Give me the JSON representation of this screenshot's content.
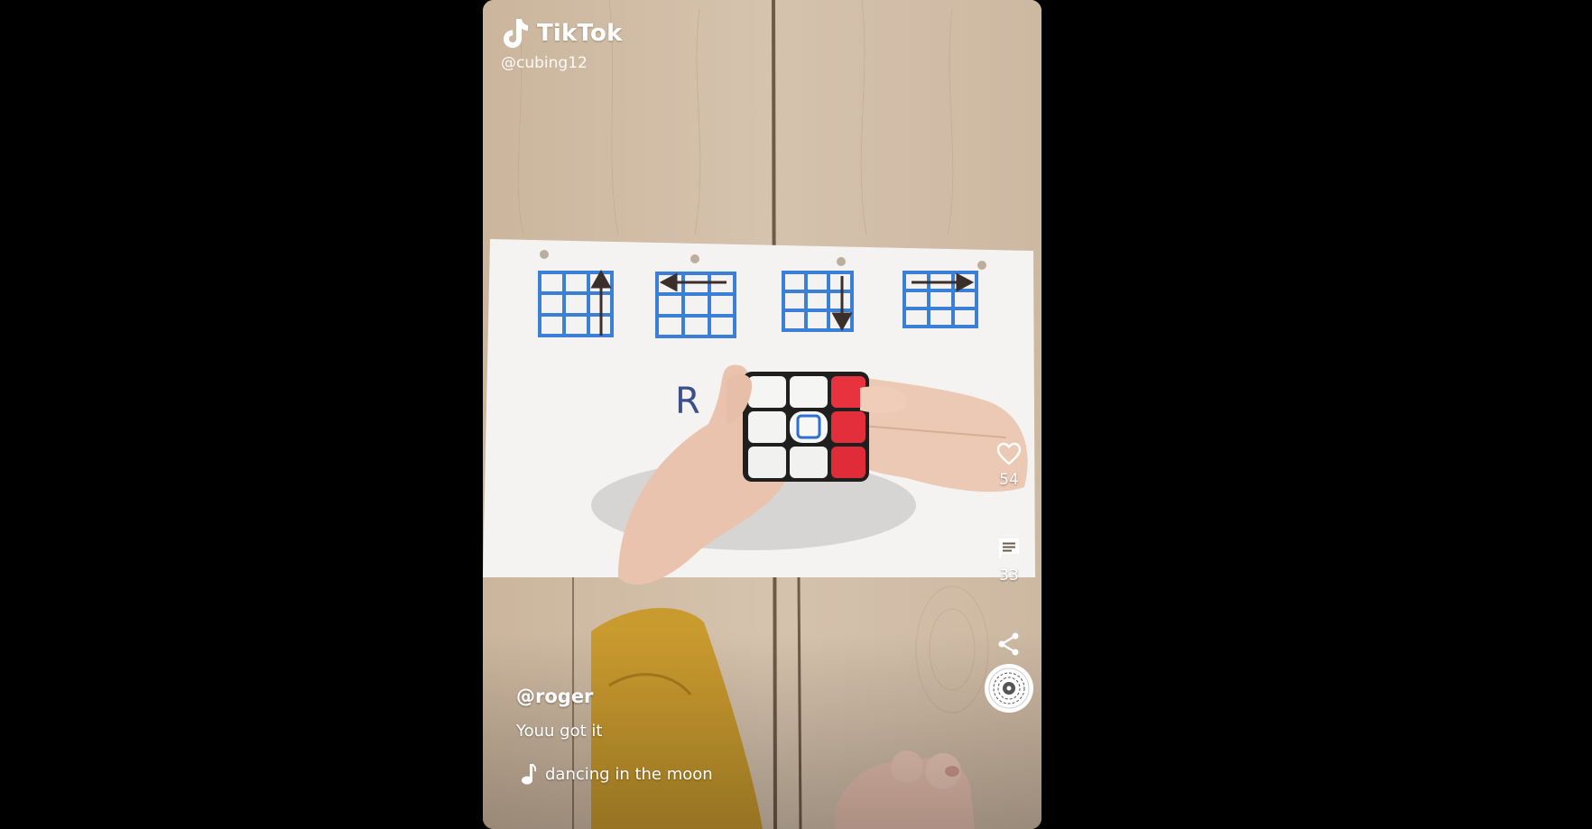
{
  "watermark": {
    "brand": "TikTok",
    "handle": "@cubing12"
  },
  "actions": {
    "likes": "54",
    "comments": "33"
  },
  "post": {
    "author": "@roger",
    "description": "Youu got it",
    "music": "dancing in the moon"
  },
  "colors": {
    "background": "#000000",
    "text": "#ffffff",
    "grid_blue": "#3b7fd6",
    "cube_red": "#e8333f"
  },
  "icons": {
    "logo": "tiktok-logo-icon",
    "like": "heart-icon",
    "comment": "comment-icon",
    "share": "share-icon",
    "disc": "music-disc-icon",
    "note": "music-note-icon"
  }
}
